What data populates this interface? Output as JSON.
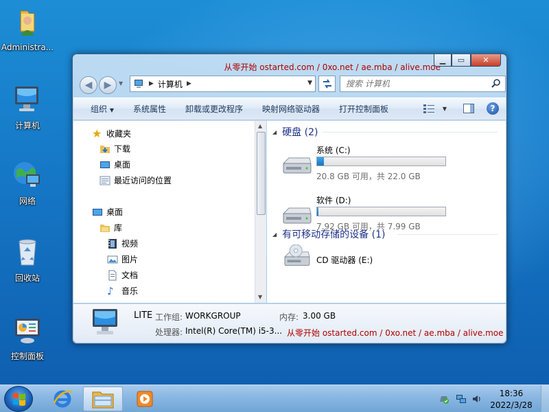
{
  "desktop": {
    "icons": [
      {
        "label": "Administra...",
        "icon": "user-folder-icon"
      },
      {
        "label": "计算机",
        "icon": "computer-icon"
      },
      {
        "label": "网络",
        "icon": "network-icon"
      },
      {
        "label": "回收站",
        "icon": "recycle-bin-icon"
      },
      {
        "label": "控制面板",
        "icon": "control-panel-icon"
      }
    ]
  },
  "window": {
    "caption": "从零开始 ostarted.com / 0xo.net / ae.mba / alive.moe",
    "address": {
      "crumb": "计算机"
    },
    "search": {
      "placeholder": "搜索 计算机"
    },
    "toolbar": {
      "organize": "组织",
      "system_properties": "系统属性",
      "uninstall": "卸载或更改程序",
      "map_drive": "映射网络驱动器",
      "open_control_panel": "打开控制面板"
    },
    "nav_tree": {
      "favorites": "收藏夹",
      "downloads": "下载",
      "desktop": "桌面",
      "recent": "最近访问的位置",
      "desktop2": "桌面",
      "libraries": "库",
      "videos": "视频",
      "pictures": "图片",
      "documents": "文档",
      "music": "音乐"
    },
    "groups": {
      "hard_disks": "硬盘 (2)",
      "removable": "有可移动存储的设备 (1)"
    },
    "drives": [
      {
        "name": "系统 (C:)",
        "size_text": "20.8 GB 可用，共 22.0 GB",
        "used_fraction": 0.055
      },
      {
        "name": "软件 (D:)",
        "size_text": "7.92 GB 可用，共 7.99 GB",
        "used_fraction": 0.009
      }
    ],
    "cd_drive": {
      "name": "CD 驱动器 (E:)"
    },
    "details": {
      "computer_name": "LITE",
      "workgroup_label": "工作组:",
      "workgroup": "WORKGROUP",
      "memory_label": "内存:",
      "memory": "3.00 GB",
      "processor_label": "处理器:",
      "processor": "Intel(R) Core(TM) i5-3...",
      "watermark": "从零开始 ostarted.com / 0xo.net / ae.mba / alive.moe"
    }
  },
  "taskbar": {
    "time": "18:36",
    "date": "2022/3/28"
  },
  "colors": {
    "accent_blue": "#1e3287",
    "watermark_red": "#b00000",
    "drive_fill": "#1a73c3"
  }
}
